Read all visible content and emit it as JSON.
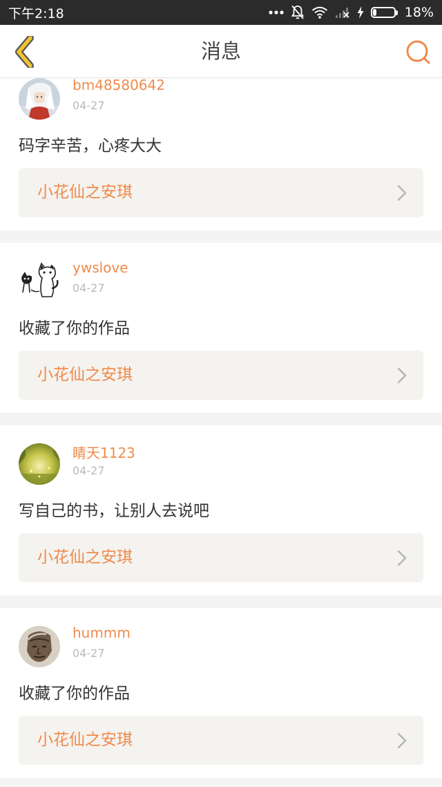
{
  "status_bar": {
    "time": "下午2:18",
    "battery_text": "18%",
    "battery_level": 0.18,
    "icons": [
      "more-dots-icon",
      "mute-bell-icon",
      "wifi-icon",
      "signal-off-icon",
      "charging-icon",
      "battery-icon"
    ]
  },
  "header": {
    "title": "消息",
    "back_icon": "chevron-left-icon",
    "search_icon": "search-icon"
  },
  "colors": {
    "accent": "#f08a4b",
    "back_arrow_fill": "#f1c232",
    "back_arrow_outline": "#555555",
    "card_bg": "#ffffff",
    "page_bg": "#f4f4f4",
    "link_bg": "#f4f3ef",
    "date": "#b9b9b9",
    "text": "#333333"
  },
  "messages": [
    {
      "username": "bm48580642",
      "date": "04-27",
      "text": "码字辛苦，心疼大大",
      "book": "小花仙之安琪",
      "avatar": "anime-avatar-white-hair"
    },
    {
      "username": "ywslove",
      "date": "04-27",
      "text": "收藏了你的作品",
      "book": "小花仙之安琪",
      "avatar": "cartoon-cats-avatar"
    },
    {
      "username": "睛天1123",
      "date": "04-27",
      "text": "写自己的书，让别人去说吧",
      "book": "小花仙之安琪",
      "avatar": "green-landscape-avatar"
    },
    {
      "username": "hummm",
      "date": "04-27",
      "text": "收藏了你的作品",
      "book": "小花仙之安琪",
      "avatar": "old-man-portrait-avatar"
    }
  ]
}
